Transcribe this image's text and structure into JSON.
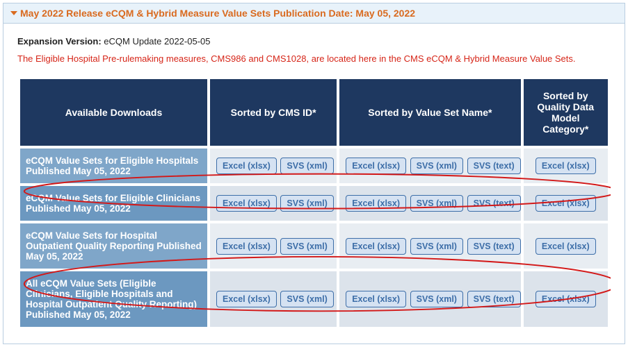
{
  "panel_title": "May 2022 Release eCQM & Hybrid Measure Value Sets Publication Date: May 05, 2022",
  "expansion_label": "Expansion Version:",
  "expansion_value": "eCQM Update 2022-05-05",
  "notice": "The Eligible Hospital Pre-rulemaking measures, CMS986 and CMS1028, are located here in the CMS eCQM & Hybrid Measure Value Sets.",
  "headers": {
    "col1": "Available Downloads",
    "col2": "Sorted by CMS ID*",
    "col3": "Sorted by Value Set Name*",
    "col4": "Sorted by Quality Data Model Category*"
  },
  "btn_labels": {
    "excel_xlsx": "Excel (xlsx)",
    "svs_xml": "SVS (xml)",
    "svs_text": "SVS (text)"
  },
  "rows": [
    {
      "label": "eCQM Value Sets for Eligible Hospitals Published May 05, 2022"
    },
    {
      "label": "eCQM Value Sets for Eligible Clinicians Published May 05, 2022"
    },
    {
      "label": "eCQM Value Sets for Hospital Outpatient Quality Reporting Published May 05, 2022"
    },
    {
      "label": "All eCQM Value Sets (Eligible Clinicians, Eligible Hospitals and Hospital Outpatient Quality Reporting) Published May 05, 2022"
    }
  ]
}
